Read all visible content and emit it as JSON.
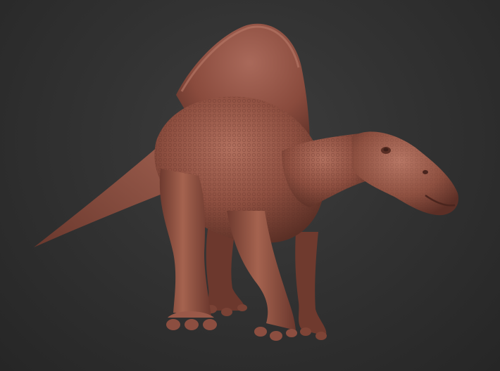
{
  "scene": {
    "subject": "dinosaur-sculpt",
    "background_color": "#2b2b2b",
    "material_color": "#8e4f40",
    "highlight_color": "#b2705e",
    "shadow_color": "#4e2a22"
  }
}
